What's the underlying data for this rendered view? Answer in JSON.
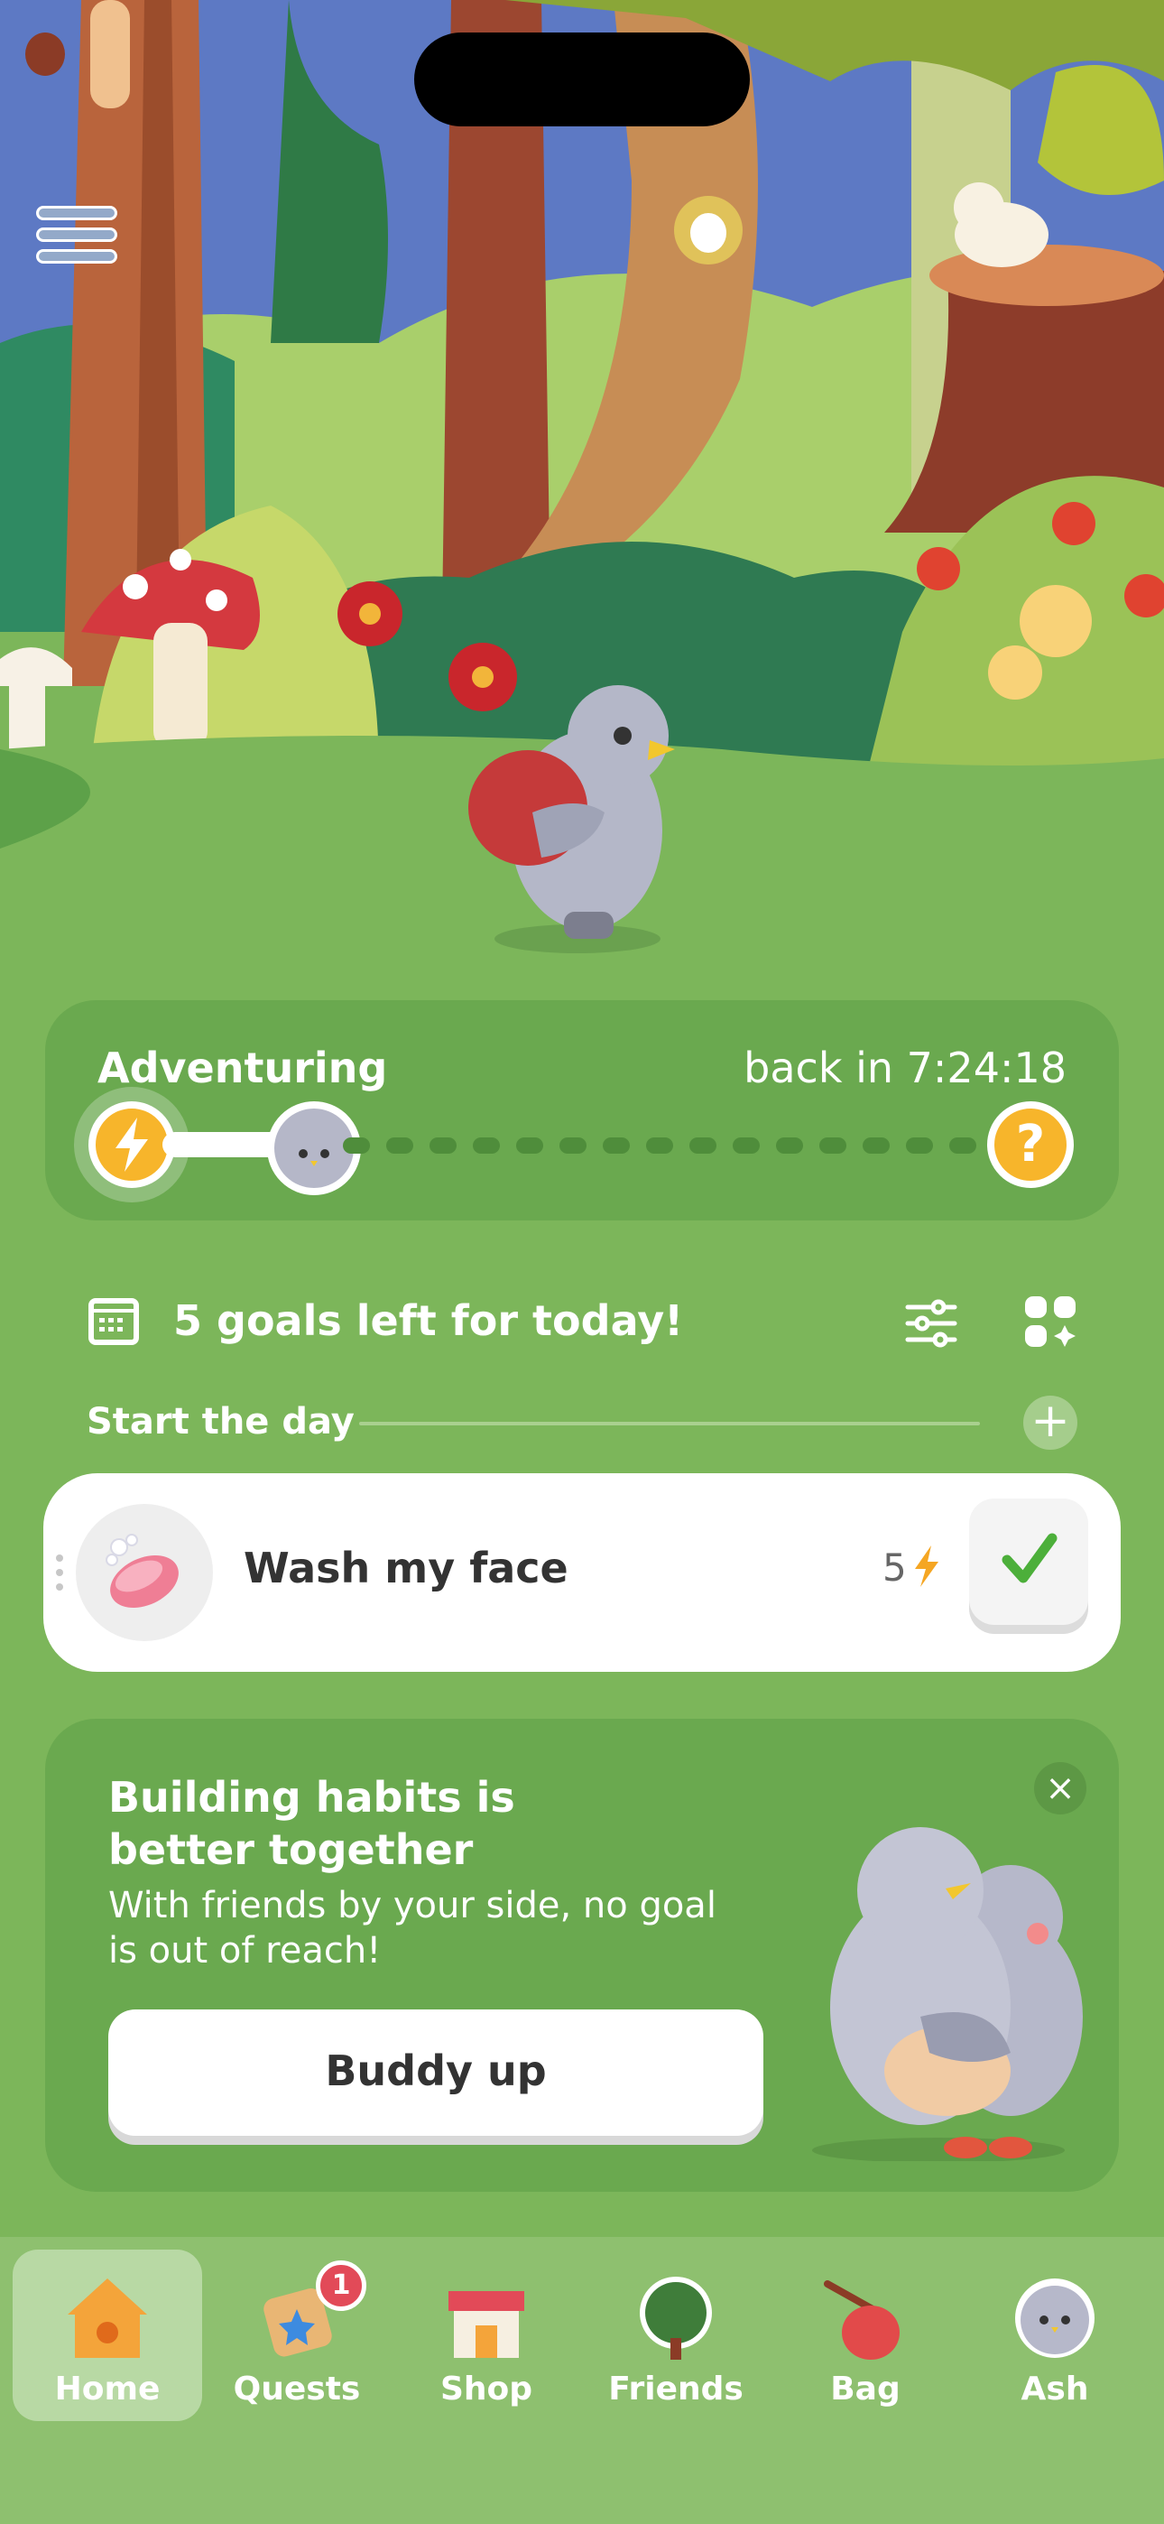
{
  "scene": {
    "description_label": "forest"
  },
  "adventure": {
    "title": "Adventuring",
    "timer": "back in 7:24:18"
  },
  "goals": {
    "heading": "5 goals left for today!",
    "section_label": "Start the day",
    "items": [
      {
        "name": "Wash my face",
        "points": "5"
      }
    ]
  },
  "promo": {
    "title": "Building habits is better together",
    "body": "With friends by your side, no goal is out of reach!",
    "button": "Buddy up"
  },
  "tabbar": {
    "tabs": [
      {
        "label": "Home",
        "icon": "house-icon",
        "active": true
      },
      {
        "label": "Quests",
        "icon": "quests-icon",
        "badge": "1"
      },
      {
        "label": "Shop",
        "icon": "shop-icon"
      },
      {
        "label": "Friends",
        "icon": "tree-icon"
      },
      {
        "label": "Bag",
        "icon": "bag-icon"
      },
      {
        "label": "Ash",
        "icon": "pigeon-avatar-icon"
      }
    ]
  },
  "colors": {
    "grass": "#7cb65a",
    "card": "#6aa94f",
    "accent_yellow": "#f7b52b",
    "check_green": "#4caf3a",
    "badge_red": "#e24a58"
  }
}
